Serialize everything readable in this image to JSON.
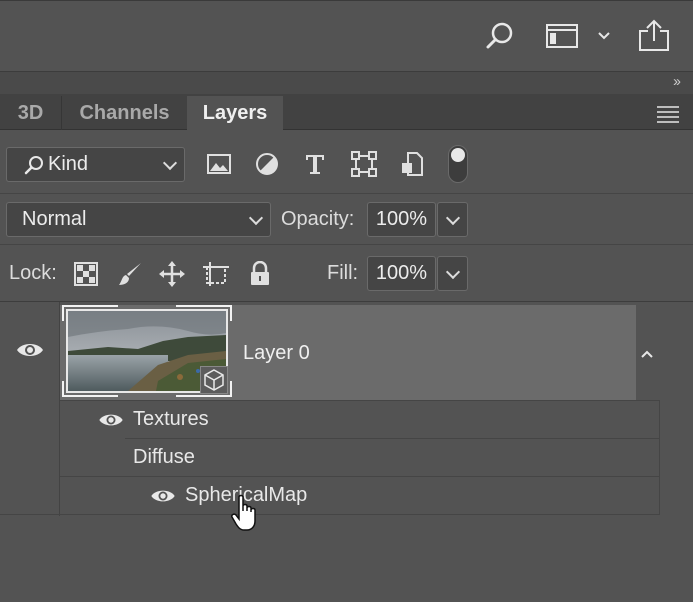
{
  "toolbar": {
    "icons": [
      "search-icon",
      "workspace-icon",
      "chevron-down-icon",
      "share-icon"
    ]
  },
  "collapse": {
    "label": "››"
  },
  "tabs": [
    {
      "label": "3D",
      "active": false
    },
    {
      "label": "Channels",
      "active": false
    },
    {
      "label": "Layers",
      "active": true
    }
  ],
  "filter": {
    "kind_label": "Kind",
    "icons": [
      "image-filter-icon",
      "adjustment-filter-icon",
      "type-filter-icon",
      "shape-filter-icon",
      "smart-object-filter-icon",
      "filter-toggle-icon"
    ]
  },
  "blend": {
    "mode": "Normal",
    "opacity_label": "Opacity:",
    "opacity_value": "100%"
  },
  "lock": {
    "label": "Lock:",
    "icons": [
      "lock-transparent-icon",
      "lock-image-icon",
      "lock-position-icon",
      "lock-artboard-icon",
      "lock-all-icon"
    ],
    "fill_label": "Fill:",
    "fill_value": "100%"
  },
  "layers": [
    {
      "name": "Layer 0",
      "visible": true,
      "selected": true,
      "type_icon": "3d-cube-icon",
      "children": [
        {
          "name": "Textures",
          "visible": true,
          "indent": 1
        },
        {
          "name": "Diffuse",
          "visible": null,
          "indent": 2
        },
        {
          "name": "SphericalMap",
          "visible": true,
          "indent": 3
        }
      ]
    }
  ],
  "colors": {
    "panel": "#535353",
    "tabbar": "#424242",
    "selected_row": "#6b6b6b",
    "field": "#454545"
  }
}
